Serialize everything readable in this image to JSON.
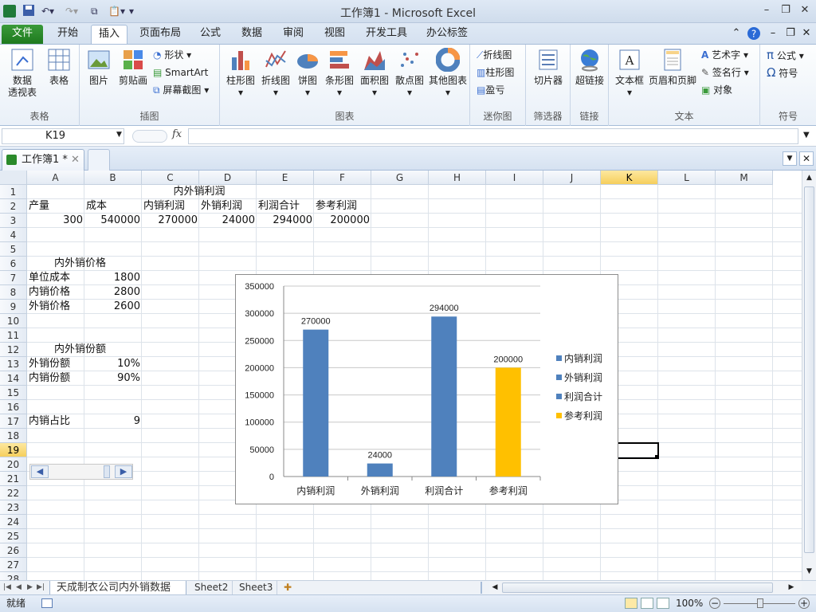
{
  "window": {
    "title": "工作簿1 - Microsoft Excel"
  },
  "tabs": [
    "文件",
    "开始",
    "插入",
    "页面布局",
    "公式",
    "数据",
    "审阅",
    "视图",
    "开发工具",
    "办公标签"
  ],
  "ribbon": {
    "groups": {
      "tables": "表格",
      "illustrations": "插图",
      "charts": "图表",
      "sparklines": "迷你图",
      "filter": "筛选器",
      "links": "链接",
      "text": "文本",
      "symbols": "符号"
    },
    "pivot": [
      "数据",
      "透视表"
    ],
    "table": "表格",
    "picture": "图片",
    "clipart": "剪贴画",
    "shapes": "形状",
    "smartart": "SmartArt",
    "screenshot": "屏幕截图",
    "charts": [
      "柱形图",
      "折线图",
      "饼图",
      "条形图",
      "面积图",
      "散点图",
      "其他图表"
    ],
    "spark": [
      "折线图",
      "柱形图",
      "盈亏"
    ],
    "slicer": "切片器",
    "hyperlink": "超链接",
    "textbox": "文本框",
    "headerfooter": "页眉和页脚",
    "wordart": "艺术字",
    "signature": "签名行",
    "object": "对象",
    "equation": "公式",
    "symbol": "符号"
  },
  "formula": {
    "namebox": "K19",
    "fx": "fx"
  },
  "workbook_tab": "工作簿1 *",
  "columns": [
    "A",
    "B",
    "C",
    "D",
    "E",
    "F",
    "G",
    "H",
    "I",
    "J",
    "K",
    "L",
    "M"
  ],
  "rows": [
    "1",
    "2",
    "3",
    "4",
    "5",
    "6",
    "7",
    "8",
    "9",
    "10",
    "11",
    "12",
    "13",
    "14",
    "15",
    "16",
    "17",
    "18",
    "19",
    "20",
    "21",
    "22",
    "23",
    "24",
    "25",
    "26",
    "27",
    "28"
  ],
  "selected_row": "19",
  "cells": {
    "c1": "内外销利润",
    "r2": [
      "产量",
      "成本",
      "内销利润",
      "外销利润",
      "利润合计",
      "参考利润"
    ],
    "r3": [
      "300",
      "540000",
      "270000",
      "24000",
      "294000",
      "200000"
    ],
    "a6": "内外销价格",
    "a7": "单位成本",
    "b7": "1800",
    "a8": "内销价格",
    "b8": "2800",
    "a9": "外销价格",
    "b9": "2600",
    "a12": "内外销份额",
    "a13": "外销份额",
    "b13": "10%",
    "a14": "内销份额",
    "b14": "90%",
    "a17": "内销占比",
    "b17": "9"
  },
  "sheets": [
    "天成制衣公司内外销数据",
    "Sheet2",
    "Sheet3"
  ],
  "status": {
    "ready": "就绪",
    "zoom": "100%"
  },
  "colors": {
    "series_blue": "#4f81bd",
    "highlight": "#ffc000",
    "file_tab": "#2a8a2a"
  },
  "chart_data": {
    "type": "bar",
    "categories": [
      "内销利润",
      "外销利润",
      "利润合计",
      "参考利润"
    ],
    "values": [
      270000,
      24000,
      294000,
      200000
    ],
    "data_labels": [
      "270000",
      "24000",
      "294000",
      "200000"
    ],
    "bar_colors": [
      "#4f81bd",
      "#4f81bd",
      "#4f81bd",
      "#ffc000"
    ],
    "yticks": [
      "0",
      "50000",
      "100000",
      "150000",
      "200000",
      "250000",
      "300000",
      "350000"
    ],
    "ylim": [
      0,
      350000
    ],
    "legend": [
      "内销利润",
      "外销利润",
      "利润合计",
      "参考利润"
    ],
    "legend_colors": [
      "#4f81bd",
      "#4f81bd",
      "#4f81bd",
      "#ffc000"
    ],
    "legend_position": "right",
    "grid": true
  }
}
